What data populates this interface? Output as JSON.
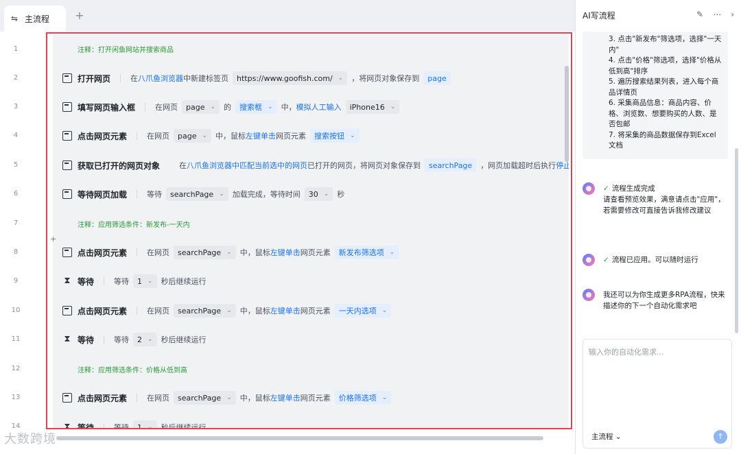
{
  "tabs": {
    "active_label": "主流程",
    "add_label": "+"
  },
  "line_numbers": [
    "1",
    "2",
    "3",
    "4",
    "5",
    "6",
    "7",
    "8",
    "9",
    "10",
    "11",
    "12",
    "13",
    "14"
  ],
  "rows": {
    "r1": {
      "text": "注释：打开闲鱼网站并搜索商品"
    },
    "r2": {
      "name": "打开网页",
      "p1": "在",
      "link1": "八爪鱼浏览器",
      "p2": "中新建标签页",
      "url": "https://www.goofish.com/",
      "p3": "，将网页对象保存到",
      "var": "page"
    },
    "r3": {
      "name": "填写网页输入框",
      "p1": "在网页",
      "v1": "page",
      "p2": "的",
      "v2": "搜索框",
      "p3": "中，",
      "link1": "模拟人工输入",
      "v3": "iPhone16"
    },
    "r4": {
      "name": "点击网页元素",
      "p1": "在网页",
      "v1": "page",
      "p2": "中，鼠标",
      "link1": "左键单击",
      "p3": "网页元素",
      "v2": "搜索按钮"
    },
    "r5": {
      "name": "获取已打开的网页对象",
      "p1": "在",
      "link1": "八爪鱼浏览器中匹配当前选中的网页",
      "p2": "已打开的网页，将网页对象保存到",
      "var": "searchPage",
      "p3": "，网页加载超时后执行",
      "link2": "停止加载"
    },
    "r6": {
      "name": "等待网页加载",
      "p1": "等待",
      "v1": "searchPage",
      "p2": "加载完成，等待时间",
      "v2": "30",
      "p3": "秒"
    },
    "r7": {
      "text": "注释：应用筛选条件：新发布-一天内"
    },
    "r8": {
      "name": "点击网页元素",
      "p1": "在网页",
      "v1": "searchPage",
      "p2": "中，鼠标",
      "link1": "左键单击",
      "p3": "网页元素",
      "v2": "新发布筛选项"
    },
    "r9": {
      "name": "等待",
      "p1": "等待",
      "v1": "1",
      "p2": "秒后继续运行"
    },
    "r10": {
      "name": "点击网页元素",
      "p1": "在网页",
      "v1": "searchPage",
      "p2": "中，鼠标",
      "link1": "左键单击",
      "p3": "网页元素",
      "v2": "一天内选项"
    },
    "r11": {
      "name": "等待",
      "p1": "等待",
      "v1": "2",
      "p2": "秒后继续运行"
    },
    "r12": {
      "text": "注释：应用筛选条件：价格从低到高"
    },
    "r13": {
      "name": "点击网页元素",
      "p1": "在网页",
      "v1": "searchPage",
      "p2": "中，鼠标",
      "link1": "左键单击",
      "p3": "网页元素",
      "v2": "价格筛选项"
    },
    "r14": {
      "name": "等待",
      "p1": "等待",
      "v1": "1",
      "p2": "秒后继续运行"
    }
  },
  "watermark": "大数跨境",
  "right": {
    "title": "AI写流程",
    "steps": [
      "3. 点击\"新发布\"筛选项，选择\"一天内\"",
      "4. 点击\"价格\"筛选项，选择\"价格从低到高\"排序",
      "5. 遍历搜索结果列表，进入每个商品详情页",
      "6. 采集商品信息：商品内容、价格、浏览数、想要购买的人数、是否包邮",
      "7. 将采集的商品数据保存到Excel文档"
    ],
    "msg1_title": "流程生成完成",
    "msg1_body": "请查看预览效果，满意请点击\"应用\"，若需要修改可直接告诉我修改建议",
    "msg2": "流程已应用。可以随时运行",
    "msg3": "我还可以为你生成更多RPA流程，快来描述你的下一个自动化需求吧",
    "input_placeholder": "输入你的自动化需求...",
    "flow_select": "主流程"
  }
}
